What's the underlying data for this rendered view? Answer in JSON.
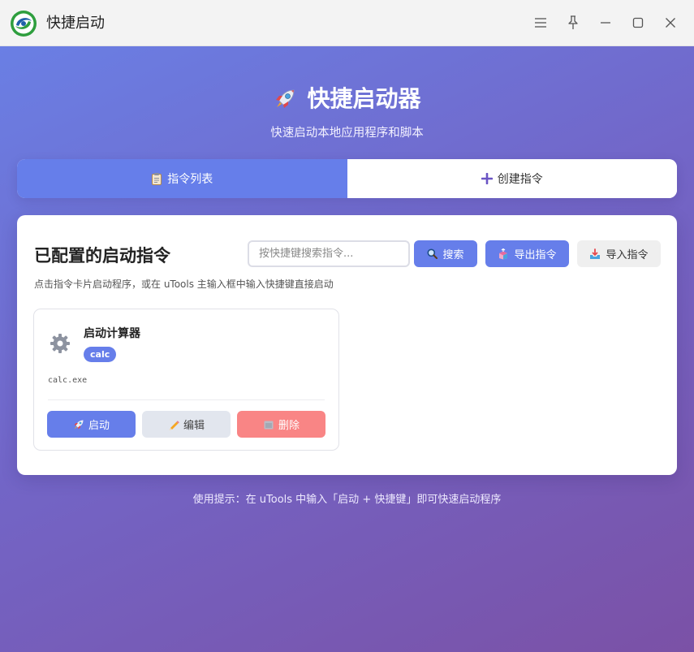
{
  "window": {
    "title": "快捷启动",
    "logo_icon": "utools-logo-icon",
    "controls": [
      "menu-icon",
      "pin-icon",
      "minimize-icon",
      "maximize-icon",
      "close-icon"
    ]
  },
  "header": {
    "title": "快捷启动器",
    "title_icon": "rocket-icon",
    "subtitle": "快速启动本地应用程序和脚本"
  },
  "tabs": [
    {
      "label": "指令列表",
      "icon": "clipboard-icon",
      "active": true
    },
    {
      "label": "创建指令",
      "icon": "plus-icon",
      "active": false
    }
  ],
  "panel": {
    "title": "已配置的启动指令",
    "search_placeholder": "按快捷键搜索指令...",
    "search_button": "搜索",
    "export_button": "导出指令",
    "import_button": "导入指令",
    "hint": "点击指令卡片启动程序，或在 uTools 主输入框中输入快捷键直接启动"
  },
  "commands": [
    {
      "name": "启动计算器",
      "keyword": "calc",
      "path": "calc.exe",
      "icon": "gear-icon",
      "launch_label": "启动",
      "edit_label": "编辑",
      "delete_label": "删除"
    }
  ],
  "footer": {
    "tip": "使用提示：在 uTools 中输入「启动 + 快捷键」即可快速启动程序"
  },
  "colors": {
    "accent": "#667eea",
    "delete": "#f98585",
    "edit": "#e2e6ee"
  }
}
